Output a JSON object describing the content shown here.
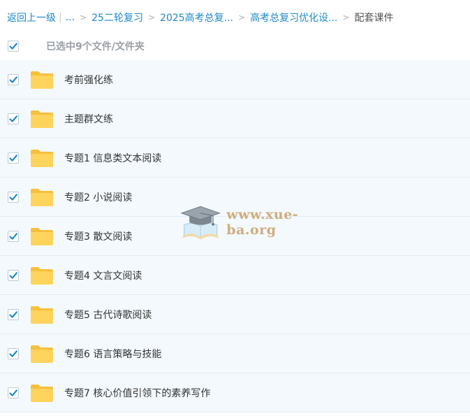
{
  "breadcrumb": {
    "back": "返回上一级",
    "ellipsis": "...",
    "items": [
      "25二轮复习",
      "2025高考总复...",
      "高考总复习优化设..."
    ],
    "current": "配套课件"
  },
  "select_all": {
    "checked": true,
    "text": "已选中9个文件/文件夹"
  },
  "files": [
    {
      "name": "考前强化练",
      "checked": true,
      "icon": "folder-icon"
    },
    {
      "name": "主题群文练",
      "checked": true,
      "icon": "folder-icon"
    },
    {
      "name": "专题1 信息类文本阅读",
      "checked": true,
      "icon": "folder-icon"
    },
    {
      "name": "专题2 小说阅读",
      "checked": true,
      "icon": "folder-icon"
    },
    {
      "name": "专题3 散文阅读",
      "checked": true,
      "icon": "folder-icon"
    },
    {
      "name": "专题4 文言文阅读",
      "checked": true,
      "icon": "folder-icon"
    },
    {
      "name": "专题5 古代诗歌阅读",
      "checked": true,
      "icon": "folder-icon"
    },
    {
      "name": "专题6 语言策略与技能",
      "checked": true,
      "icon": "folder-icon"
    },
    {
      "name": "专题7 核心价值引领下的素养写作",
      "checked": true,
      "icon": "folder-icon"
    }
  ],
  "watermark": {
    "text": "www.xue-ba.org",
    "icon": "graduation-cap-icon"
  },
  "colors": {
    "link": "#1e88c7",
    "check": "#1e88c7",
    "folder": "#ffcd4d",
    "row_bg": "#f3f9fd",
    "watermark": "#c9a06a"
  }
}
